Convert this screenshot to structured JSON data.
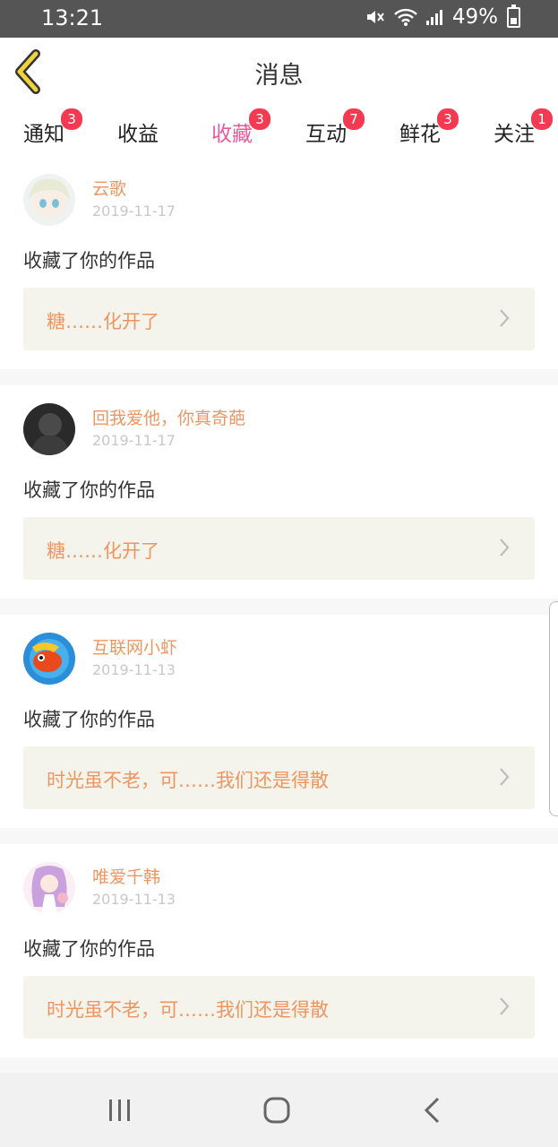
{
  "status_bar": {
    "time": "13:21",
    "battery": "49%",
    "icons": [
      "mute-icon",
      "wifi-icon",
      "signal-icon",
      "battery-icon"
    ]
  },
  "header": {
    "title": "消息",
    "back_icon": "chevron-left-icon",
    "accent": "#f0d23c"
  },
  "tabs": [
    {
      "label": "通知",
      "badge": "3",
      "active": false
    },
    {
      "label": "收益",
      "badge": "",
      "active": false
    },
    {
      "label": "收藏",
      "badge": "3",
      "active": true
    },
    {
      "label": "互动",
      "badge": "7",
      "active": false
    },
    {
      "label": "鲜花",
      "badge": "3",
      "active": false
    },
    {
      "label": "关注",
      "badge": "1",
      "active": false
    }
  ],
  "messages": [
    {
      "user": "云歌",
      "date": "2019-11-17",
      "action": "收藏了你的作品",
      "work": "糖……化开了"
    },
    {
      "user": "回我爱他，你真奇葩",
      "date": "2019-11-17",
      "action": "收藏了你的作品",
      "work": "糖……化开了"
    },
    {
      "user": "互联网小虾",
      "date": "2019-11-13",
      "action": "收藏了你的作品",
      "work": "时光虽不老，可……我们还是得散"
    },
    {
      "user": "唯爱千韩",
      "date": "2019-11-13",
      "action": "收藏了你的作品",
      "work": "时光虽不老，可……我们还是得散"
    }
  ],
  "colors": {
    "accent_pink": "#e85b9a",
    "badge_red": "#f33a52",
    "username_orange": "#ee9660",
    "work_bg": "#f4f3ec"
  },
  "nav_bar": {
    "icons": [
      "recent-apps-icon",
      "home-icon",
      "back-icon"
    ]
  }
}
